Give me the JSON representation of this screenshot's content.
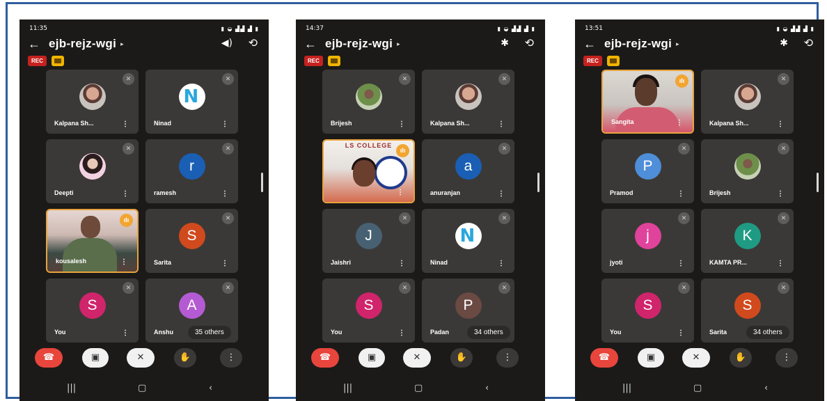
{
  "phones": [
    {
      "time": "11:35",
      "meeting_code": "ejb-rejz-wgi",
      "rec_label": "REC",
      "icon_right1": "speaker-icon",
      "tiles": [
        {
          "name": "Kalpana Sh...",
          "type": "photo",
          "photo": "a",
          "status": "mute"
        },
        {
          "name": "Ninad",
          "type": "photo",
          "photo": "n",
          "status": "mute"
        },
        {
          "name": "Deepti",
          "type": "photo",
          "photo": "c",
          "status": "mute"
        },
        {
          "name": "ramesh",
          "type": "letter",
          "letter": "r",
          "color": "#1a5fb4",
          "status": "mute"
        },
        {
          "name": "kousalesh",
          "type": "video",
          "video": "kous",
          "status": "talk",
          "active": true
        },
        {
          "name": "Sarita",
          "type": "letter",
          "letter": "S",
          "color": "#d14a1d",
          "status": "mute"
        },
        {
          "name": "You",
          "type": "letter",
          "letter": "S",
          "color": "#d0246b",
          "status": "mute"
        },
        {
          "name": "Anshu",
          "type": "letter",
          "letter": "A",
          "color": "#b45bd3",
          "status": "mute"
        }
      ],
      "others": "35 others"
    },
    {
      "time": "14:37",
      "meeting_code": "ejb-rejz-wgi",
      "rec_label": "REC",
      "icon_right1": "bluetooth-icon",
      "tiles": [
        {
          "name": "Brijesh",
          "type": "photo",
          "photo": "b",
          "status": "mute"
        },
        {
          "name": "Kalpana Sh...",
          "type": "photo",
          "photo": "a",
          "status": "mute"
        },
        {
          "name": "",
          "type": "video",
          "video": "mid",
          "status": "talk",
          "active": true,
          "banner": "LS COLLEGE"
        },
        {
          "name": "anuranjan",
          "type": "letter",
          "letter": "a",
          "color": "#1a5fb4",
          "status": "mute"
        },
        {
          "name": "Jaishri",
          "type": "letter",
          "letter": "J",
          "color": "#476173",
          "status": "mute"
        },
        {
          "name": "Ninad",
          "type": "photo",
          "photo": "n",
          "status": "mute"
        },
        {
          "name": "You",
          "type": "letter",
          "letter": "S",
          "color": "#d0246b",
          "status": "mute"
        },
        {
          "name": "Padan",
          "type": "letter",
          "letter": "P",
          "color": "#6a4a43",
          "status": "mute"
        }
      ],
      "others": "34 others"
    },
    {
      "time": "13:51",
      "meeting_code": "ejb-rejz-wgi",
      "rec_label": "REC",
      "icon_right1": "bluetooth-icon",
      "tiles": [
        {
          "name": "Sangita",
          "type": "video",
          "video": "sar",
          "status": "talk",
          "active": true
        },
        {
          "name": "Kalpana Sh...",
          "type": "photo",
          "photo": "a",
          "status": "mute"
        },
        {
          "name": "Pramod",
          "type": "letter",
          "letter": "P",
          "color": "#4f8ed8",
          "status": "mute"
        },
        {
          "name": "Brijesh",
          "type": "photo",
          "photo": "b",
          "status": "mute"
        },
        {
          "name": "jyoti",
          "type": "letter",
          "letter": "j",
          "color": "#e0439b",
          "status": "mute"
        },
        {
          "name": "KAMTA PR...",
          "type": "letter",
          "letter": "K",
          "color": "#1f9b83",
          "status": "mute"
        },
        {
          "name": "You",
          "type": "letter",
          "letter": "S",
          "color": "#d0246b",
          "status": "mute"
        },
        {
          "name": "Sarita",
          "type": "letter",
          "letter": "S",
          "color": "#d14a1d",
          "status": "mute"
        }
      ],
      "others": "34 others"
    }
  ]
}
